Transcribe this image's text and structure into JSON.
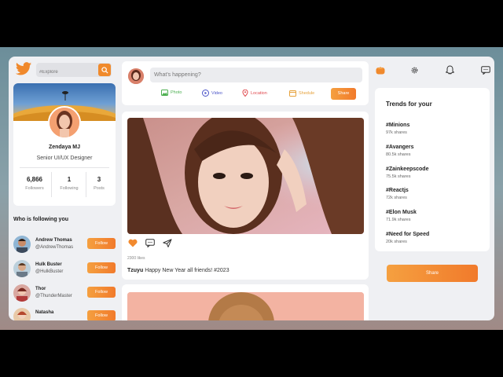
{
  "search": {
    "placeholder": "#Explore"
  },
  "profile": {
    "name": "Zendaya MJ",
    "title": "Senior UI/UX Designer",
    "stats": [
      {
        "value": "6,866",
        "label": "Followers"
      },
      {
        "value": "1",
        "label": "Following"
      },
      {
        "value": "3",
        "label": "Posts"
      }
    ]
  },
  "following": {
    "title": "Who is following you",
    "button_label": "Follow",
    "users": [
      {
        "name": "Andrew Thomas",
        "handle": "@AndrewThomas"
      },
      {
        "name": "Hulk Buster",
        "handle": "@HulkBuster"
      },
      {
        "name": "Thor",
        "handle": "@ThunderMaster"
      },
      {
        "name": "Natasha",
        "handle": ""
      }
    ]
  },
  "compose": {
    "placeholder": "What's happening?",
    "actions": [
      "Photo",
      "Video",
      "Location",
      "Shedule"
    ],
    "share_label": "Share"
  },
  "post": {
    "likes": "2300 likes",
    "author": "Tzuyu",
    "text": "Happy New Year all friends! #2023"
  },
  "trends": {
    "title": "Trends for your",
    "items": [
      {
        "tag": "#Minions",
        "count": "97k shares"
      },
      {
        "tag": "#Avangers",
        "count": "80.5k shares"
      },
      {
        "tag": "#Zainkeepscode",
        "count": "75.5k shares"
      },
      {
        "tag": "#Reactjs",
        "count": "72k shares"
      },
      {
        "tag": "#Elon Musk",
        "count": "71.9k shares"
      },
      {
        "tag": "#Need for Speed",
        "count": "20k shares"
      }
    ]
  },
  "right": {
    "share_label": "Share"
  },
  "colors": {
    "accent": "#f17a2b",
    "accent_light": "#f5a040",
    "background": "#eff0f3"
  }
}
